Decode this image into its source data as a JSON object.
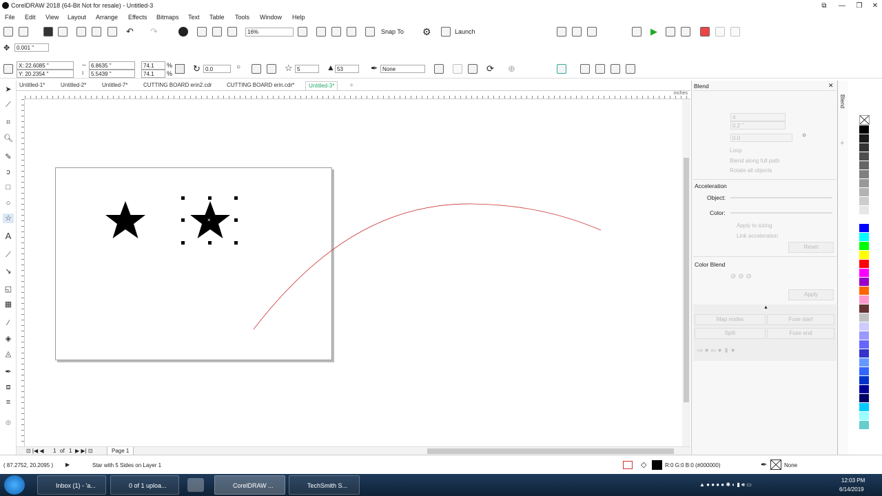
{
  "window": {
    "title": "CorelDRAW 2018 (64-Bit Not for resale) - Untitled-3",
    "controls": [
      "—",
      "❒",
      "✕"
    ]
  },
  "menu": [
    "File",
    "Edit",
    "View",
    "Layout",
    "Arrange",
    "Effects",
    "Bitmaps",
    "Text",
    "Table",
    "Tools",
    "Window",
    "Help"
  ],
  "standard_toolbar": {
    "zoom_value": "16%",
    "snap_to_label": "Snap To",
    "launch_label": "Launch"
  },
  "nudge": {
    "value": "0.001 \""
  },
  "property_bar": {
    "x": "X: 22.6085 \"",
    "y": "Y: 20.2354 \"",
    "width": "6.8635 \"",
    "height": "5.5439 \"",
    "scale_w": "74.1",
    "scale_h": "74.1",
    "percent": "%",
    "rotation": "0.0",
    "points": "5",
    "sharpness": "53",
    "outline": "None"
  },
  "doc_tabs": [
    "Untitled-1*",
    "Untitled-2*",
    "Untitled-7*",
    "CUTTING BOARD erin2.cdr",
    "CUTTING BOARD erin.cdr*",
    "Untitled-3*"
  ],
  "active_tab": "Untitled-3*",
  "ruler_units": "inches",
  "page_nav": {
    "current": "1",
    "of_label": "of",
    "total": "1",
    "page_tab": "Page 1"
  },
  "docker": {
    "title": "Blend",
    "side_tab": "Blend",
    "steps": "4",
    "spacing": "0.2 \"",
    "angle": "0.0",
    "loop_label": "Loop",
    "full_path_label": "Blend along full path",
    "rotate_all_label": "Rotate all objects",
    "acceleration_label": "Acceleration",
    "object_label": "Object:",
    "color_label": "Color:",
    "apply_sizing_label": "Apply to sizing",
    "link_accel_label": "Link acceleration",
    "reset_label": "Reset",
    "color_blend_label": "Color Blend",
    "apply_label": "Apply",
    "map_nodes_label": "Map nodes",
    "fuse_start_label": "Fuse start",
    "split_label": "Split",
    "fuse_end_label": "Fuse end"
  },
  "palette_colors": [
    "#000000",
    "#1a1a1a",
    "#333333",
    "#4d4d4d",
    "#666666",
    "#808080",
    "#999999",
    "#b3b3b3",
    "#cccccc",
    "#e6e6e6",
    "#ffffff",
    "#0000ff",
    "#00ffff",
    "#00ff00",
    "#ffff00",
    "#ff0000",
    "#ff00ff",
    "#9900cc",
    "#ff6600",
    "#ff99cc",
    "#663333",
    "#c0c0c0",
    "#ccccff",
    "#9999ff",
    "#6666ff",
    "#3333cc",
    "#6699ff",
    "#3366ff",
    "#0033cc",
    "#000099",
    "#000066",
    "#00ccff",
    "#99ffff",
    "#66cccc"
  ],
  "status": {
    "coords": "( 87.2752, 20.2095 )",
    "description": "Star with 5 Sides on Layer 1",
    "fill_info": "R:0 G:0 B:0 (#000000)",
    "outline_info": "None"
  },
  "taskbar": {
    "tasks": [
      "Inbox (1) - 'a...",
      "0 of 1 uploa...",
      "CorelDRAW ...",
      "TechSmith S..."
    ],
    "time": "12:03 PM",
    "date": "6/14/2019"
  }
}
